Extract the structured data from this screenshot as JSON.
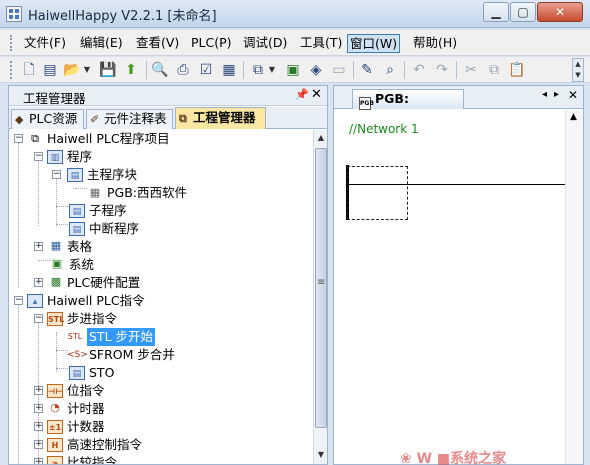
{
  "window": {
    "title": "HaiwellHappy V2.2.1 [未命名]"
  },
  "menu": [
    {
      "label": "文件(F)",
      "active": false
    },
    {
      "label": "编辑(E)",
      "active": false
    },
    {
      "label": "查看(V)",
      "active": false
    },
    {
      "label": "PLC(P)",
      "active": false
    },
    {
      "label": "调试(D)",
      "active": false
    },
    {
      "label": "工具(T)",
      "active": false
    },
    {
      "label": "窗口(W)",
      "active": true
    },
    {
      "label": "帮助(H)",
      "active": false
    }
  ],
  "toolbar": {
    "buttons": [
      "new-file-icon",
      "open-folder-icon",
      "save-icon",
      "upload-icon",
      "print-preview-icon",
      "print-icon",
      "check-icon",
      "chart-icon",
      "plc-connect-icon",
      "download-plc-icon",
      "monitor-icon",
      "compile-icon",
      "binoculars-icon",
      "undo-icon",
      "redo-icon",
      "cut-icon",
      "copy-icon",
      "paste-icon"
    ]
  },
  "left_panel": {
    "title": "工程管理器",
    "tabs": [
      {
        "label": "PLC资源",
        "active": false
      },
      {
        "label": "元件注释表",
        "active": false
      },
      {
        "label": "工程管理器",
        "active": true
      }
    ],
    "tree": [
      {
        "label": "Haiwell PLC程序项目",
        "icon": "project-icon",
        "selected": false
      },
      {
        "label": "程序",
        "icon": "program-icon",
        "selected": false
      },
      {
        "label": "主程序块",
        "icon": "main-block-icon",
        "selected": false
      },
      {
        "label": "PGB:西西软件",
        "icon": "pgb-icon",
        "selected": false
      },
      {
        "label": "子程序",
        "icon": "subprogram-icon",
        "selected": false
      },
      {
        "label": "中断程序",
        "icon": "interrupt-icon",
        "selected": false
      },
      {
        "label": "表格",
        "icon": "table-icon",
        "selected": false
      },
      {
        "label": "系统",
        "icon": "system-icon",
        "selected": false
      },
      {
        "label": "PLC硬件配置",
        "icon": "hardware-icon",
        "selected": false
      },
      {
        "label": "Haiwell PLC指令",
        "icon": "instruction-icon",
        "selected": false
      },
      {
        "label": "步进指令",
        "icon": "stl-icon",
        "selected": false
      },
      {
        "label": "STL 步开始",
        "icon": "stl-start-icon",
        "selected": true
      },
      {
        "label": "SFROM 步合并",
        "icon": "sfrom-icon",
        "selected": false
      },
      {
        "label": "STO",
        "icon": "sto-icon",
        "selected": false
      },
      {
        "label": "位指令",
        "icon": "bit-icon",
        "selected": false
      },
      {
        "label": "计时器",
        "icon": "timer-icon",
        "selected": false
      },
      {
        "label": "计数器",
        "icon": "counter-icon",
        "selected": false
      },
      {
        "label": "高速控制指令",
        "icon": "highspeed-icon",
        "selected": false
      },
      {
        "label": "比较指令",
        "icon": "compare-icon",
        "selected": false
      }
    ]
  },
  "editor": {
    "tab_label": "PGB:",
    "network_label": "//Network 1"
  },
  "watermark": "❀ W ■系统之家"
}
